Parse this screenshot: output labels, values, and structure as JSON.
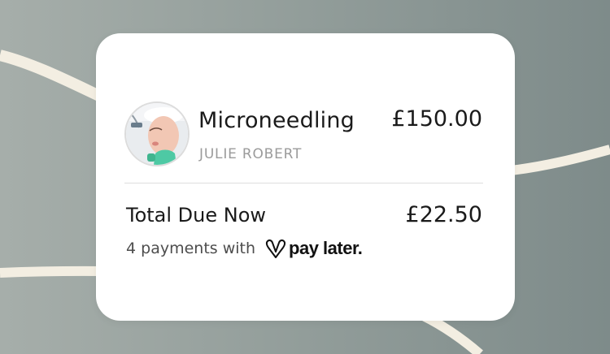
{
  "service": {
    "name": "Microneedling",
    "practitioner": "JULIE ROBERT",
    "price": "£150.00",
    "image": "microneedling-treatment-photo"
  },
  "total": {
    "label": "Total Due Now",
    "amount": "£22.50"
  },
  "payment": {
    "text": "4 payments with",
    "brand": "pay later.",
    "brand_icon": "v-heart-logo-icon"
  },
  "colors": {
    "background": "#929d9a",
    "curve": "#f3eee2",
    "card": "#ffffff",
    "divider": "#dedede",
    "secondary_text": "#9b9b9b"
  }
}
